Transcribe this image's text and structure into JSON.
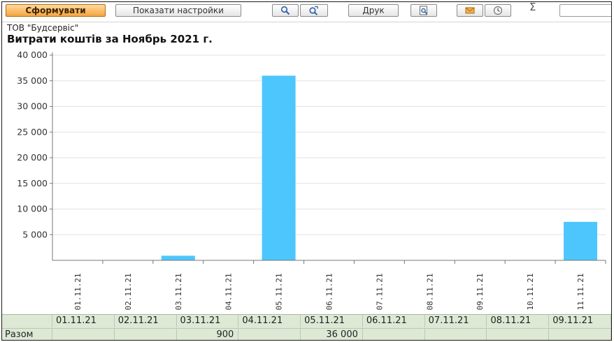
{
  "toolbar": {
    "generate_label": "Сформувати",
    "settings_label": "Показати настройки",
    "print_label": "Друк",
    "sigma_symbol": "Σ",
    "icons": [
      "search-icon",
      "search-next-icon",
      "print-preview-icon",
      "mail-icon",
      "clock-icon"
    ]
  },
  "report": {
    "company": "ТОВ \"Будсервіс\"",
    "title": "Витрати коштів за Ноябрь 2021 г."
  },
  "colors": {
    "bar": "#4dc6fd",
    "table_bg": "#dde9d5",
    "primary_button": "#f5a53f"
  },
  "chart_data": {
    "type": "bar",
    "categories": [
      "01.11.21",
      "02.11.21",
      "03.11.21",
      "04.11.21",
      "05.11.21",
      "06.11.21",
      "07.11.21",
      "08.11.21",
      "09.11.21",
      "10.11.21",
      "11.11.21"
    ],
    "values": [
      0,
      0,
      900,
      0,
      36000,
      0,
      0,
      0,
      0,
      0,
      7500
    ],
    "ylim": [
      0,
      40000
    ],
    "yticks": [
      5000,
      10000,
      15000,
      20000,
      25000,
      30000,
      35000,
      40000
    ],
    "ytick_labels": [
      "5 000",
      "10 000",
      "15 000",
      "20 000",
      "25 000",
      "30 000",
      "35 000",
      "40 000"
    ],
    "grid": true,
    "legend": "none"
  },
  "table": {
    "row_label": "Разом",
    "headers": [
      "01.11.21",
      "02.11.21",
      "03.11.21",
      "04.11.21",
      "05.11.21",
      "06.11.21",
      "07.11.21",
      "08.11.21",
      "09.11.21"
    ],
    "values": [
      "",
      "",
      "900",
      "",
      "36 000",
      "",
      "",
      "",
      ""
    ]
  }
}
